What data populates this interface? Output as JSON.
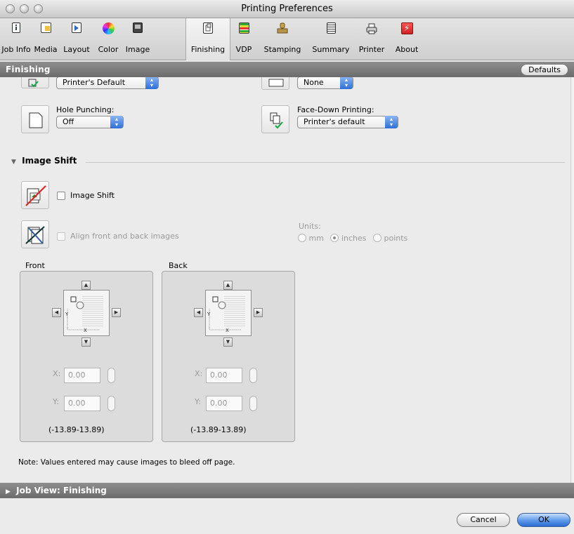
{
  "window": {
    "title": "Printing Preferences"
  },
  "toolbar": {
    "items": [
      {
        "label": "Job Info",
        "icon": "info-doc-icon"
      },
      {
        "label": "Media",
        "icon": "media-icon"
      },
      {
        "label": "Layout",
        "icon": "layout-icon"
      },
      {
        "label": "Color",
        "icon": "color-wheel-icon"
      },
      {
        "label": "Image",
        "icon": "image-icon"
      },
      {
        "label": "Finishing",
        "icon": "finishing-icon",
        "selected": true
      },
      {
        "label": "VDP",
        "icon": "vdp-icon"
      },
      {
        "label": "Stamping",
        "icon": "stamp-icon"
      },
      {
        "label": "Summary",
        "icon": "summary-icon"
      },
      {
        "label": "Printer",
        "icon": "printer-icon"
      },
      {
        "label": "About",
        "icon": "about-icon"
      }
    ]
  },
  "section": {
    "title": "Finishing",
    "defaults_label": "Defaults"
  },
  "finishing": {
    "top_left_popup": "Printer's Default",
    "top_right_popup": "None",
    "hole_punching": {
      "label": "Hole Punching:",
      "value": "Off"
    },
    "face_down": {
      "label": "Face-Down Printing:",
      "value": "Printer's default"
    }
  },
  "image_shift": {
    "header": "Image Shift",
    "enable_label": "Image Shift",
    "align_label": "Align front and back images",
    "units": {
      "label": "Units:",
      "mm": "mm",
      "inches": "inches",
      "points": "points",
      "selected": "inches"
    },
    "front": {
      "label": "Front",
      "x_label": "X:",
      "x_value": "0.00",
      "y_label": "Y:",
      "y_value": "0.00",
      "range": "(-13.89-13.89)"
    },
    "back": {
      "label": "Back",
      "x_label": "X:",
      "x_value": "0.00",
      "y_label": "Y:",
      "y_value": "0.00",
      "range": "(-13.89-13.89)"
    },
    "note": "Note: Values entered may cause images to bleed off page."
  },
  "job_view": {
    "header": "Job View: Finishing"
  },
  "buttons": {
    "cancel": "Cancel",
    "ok": "OK"
  },
  "colors": {
    "accent": "#2d6fd7",
    "header_bar": "#7a7a7a"
  }
}
